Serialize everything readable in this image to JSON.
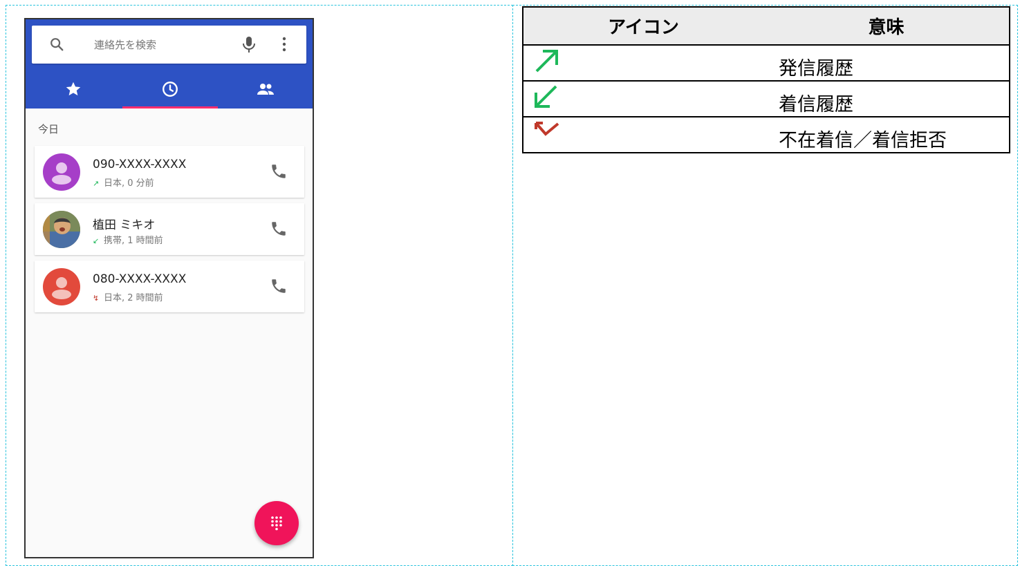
{
  "search": {
    "placeholder": "連絡先を検索"
  },
  "tabs": [
    {
      "icon": "star-icon",
      "selected": false
    },
    {
      "icon": "clock-icon",
      "selected": true
    },
    {
      "icon": "people-icon",
      "selected": false
    }
  ],
  "section_label": "今日",
  "calls": [
    {
      "name": "090-XXXX-XXXX",
      "detail": "日本, 0 分前",
      "type": "outgoing",
      "avatar_color": "#a63ec8"
    },
    {
      "name": "植田 ミキオ",
      "detail": "携帯, 1 時間前",
      "type": "incoming",
      "avatar_color": "#8d7b5c"
    },
    {
      "name": "080-XXXX-XXXX",
      "detail": "日本, 2 時間前",
      "type": "missed",
      "avatar_color": "#e24a3c"
    }
  ],
  "legend": {
    "header_icon": "アイコン",
    "header_meaning": "意味",
    "rows": [
      {
        "icon": "outgoing-call-icon",
        "meaning": "発信履歴"
      },
      {
        "icon": "incoming-call-icon",
        "meaning": "着信履歴"
      },
      {
        "icon": "missed-call-icon",
        "meaning": "不在着信／着信拒否"
      }
    ]
  },
  "colors": {
    "appbar": "#2d52c4",
    "tab_indicator": "#ff2c6d",
    "fab": "#f0145a",
    "outgoing": "#1eb85a",
    "incoming": "#1eb85a",
    "missed": "#c0392b"
  }
}
